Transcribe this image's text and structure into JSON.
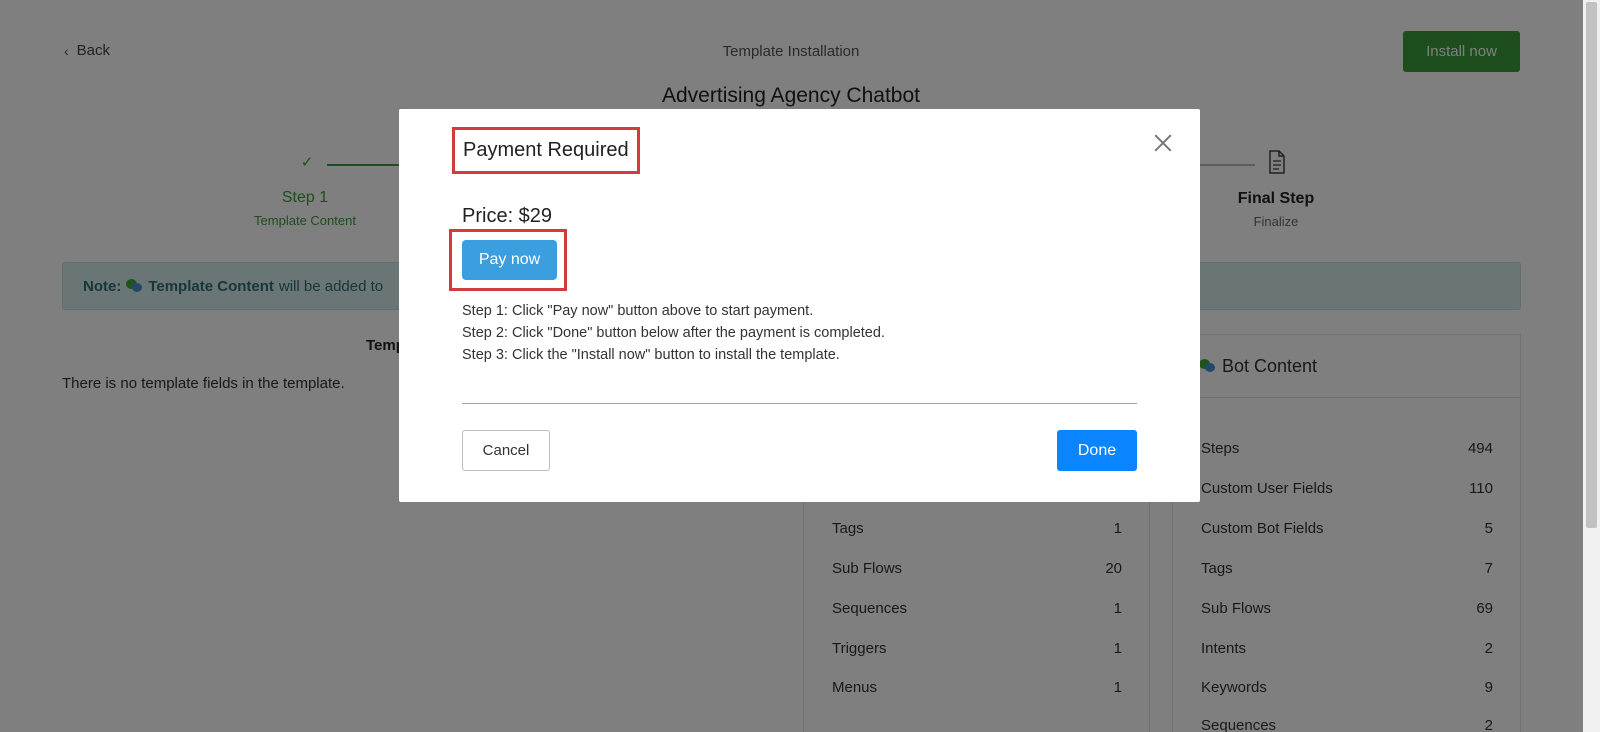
{
  "header": {
    "back_label": "Back",
    "page_title": "Template Installation",
    "install_label": "Install now",
    "bot_name": "Advertising Agency Chatbot"
  },
  "stepper": {
    "step1_title": "Step 1",
    "step1_sub": "Template Content",
    "final_title": "Final Step",
    "final_sub": "Finalize"
  },
  "note": {
    "prefix": "Note:",
    "highlight": "Template Content",
    "text": "will be added to"
  },
  "left": {
    "heading": "Temp",
    "empty_text": "There is no template fields in the template."
  },
  "panel_a": {
    "rows": [
      {
        "label": "Tags",
        "value": "1"
      },
      {
        "label": "Sub Flows",
        "value": "20"
      },
      {
        "label": "Sequences",
        "value": "1"
      },
      {
        "label": "Triggers",
        "value": "1"
      },
      {
        "label": "Menus",
        "value": "1"
      }
    ]
  },
  "panel_b": {
    "title": "Bot Content",
    "rows": [
      {
        "label": "Steps",
        "value": "494"
      },
      {
        "label": "Custom User Fields",
        "value": "110"
      },
      {
        "label": "Custom Bot Fields",
        "value": "5"
      },
      {
        "label": "Tags",
        "value": "7"
      },
      {
        "label": "Sub Flows",
        "value": "69"
      },
      {
        "label": "Intents",
        "value": "2"
      },
      {
        "label": "Keywords",
        "value": "9"
      },
      {
        "label": "Sequences",
        "value": "2"
      }
    ]
  },
  "modal": {
    "title": "Payment Required",
    "price": "Price: $29",
    "pay_label": "Pay now",
    "steps": [
      "Step 1: Click \"Pay now\" button above to start payment.",
      "Step 2: Click \"Done\" button below after the payment is completed.",
      "Step 3: Click the \"Install now\" button to install the template."
    ],
    "cancel_label": "Cancel",
    "done_label": "Done"
  },
  "colors": {
    "accent_green": "#3c9a3c",
    "done_blue": "#0a84ff",
    "pay_blue": "#3b9ede",
    "highlight_red": "#d13b3b"
  }
}
